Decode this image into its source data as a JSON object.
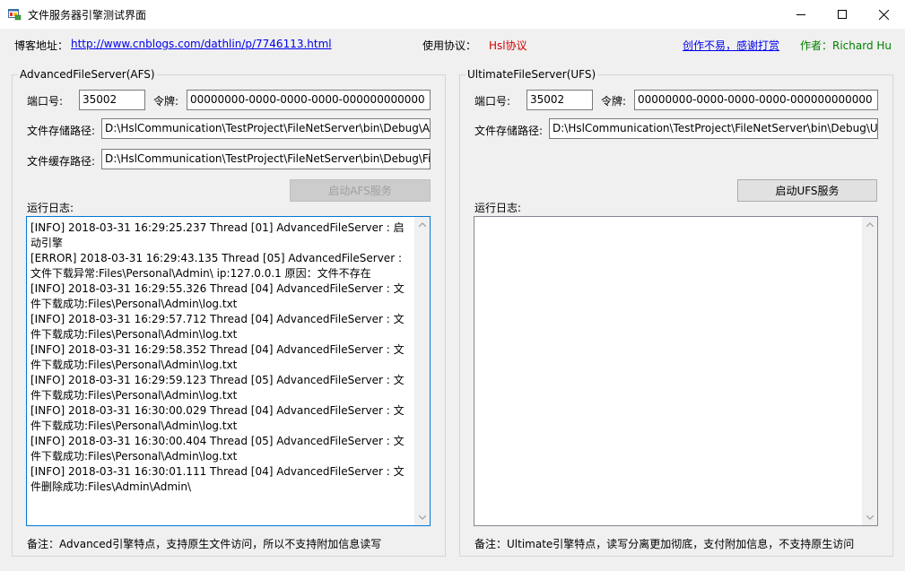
{
  "window": {
    "title": "文件服务器引擎测试界面"
  },
  "header": {
    "blog_label": "博客地址：",
    "blog_url": "http://www.cnblogs.com/dathlin/p/7746113.html",
    "protocol_label": "使用协议：",
    "protocol_value": "Hsl协议",
    "donate_link": "创作不易，感谢打赏",
    "author_label": "作者：Richard Hu"
  },
  "afs": {
    "group_title": "AdvancedFileServer(AFS)",
    "port_label": "端口号:",
    "port_value": "35002",
    "token_label": "令牌:",
    "token_value": "00000000-0000-0000-0000-000000000000",
    "storage_label": "文件存储路径:",
    "storage_value": "D:\\HslCommunication\\TestProject\\FileNetServer\\bin\\Debug\\Ac",
    "cache_label": "文件缓存路径:",
    "cache_value": "D:\\HslCommunication\\TestProject\\FileNetServer\\bin\\Debug\\File",
    "start_button": "启动AFS服务",
    "log_label": "运行日志:",
    "log_lines": [
      "[INFO] 2018-03-31 16:29:25.237 Thread [01] AdvancedFileServer : 启动引擎",
      "[ERROR] 2018-03-31 16:29:43.135 Thread [05] AdvancedFileServer : 文件下载异常:Files\\Personal\\Admin\\ ip:127.0.0.1 原因：文件不存在",
      "[INFO] 2018-03-31 16:29:55.326 Thread [04] AdvancedFileServer : 文件下载成功:Files\\Personal\\Admin\\log.txt",
      "[INFO] 2018-03-31 16:29:57.712 Thread [04] AdvancedFileServer : 文件下载成功:Files\\Personal\\Admin\\log.txt",
      "[INFO] 2018-03-31 16:29:58.352 Thread [04] AdvancedFileServer : 文件下载成功:Files\\Personal\\Admin\\log.txt",
      "[INFO] 2018-03-31 16:29:59.123 Thread [05] AdvancedFileServer : 文件下载成功:Files\\Personal\\Admin\\log.txt",
      "[INFO] 2018-03-31 16:30:00.029 Thread [04] AdvancedFileServer : 文件下载成功:Files\\Personal\\Admin\\log.txt",
      "[INFO] 2018-03-31 16:30:00.404 Thread [05] AdvancedFileServer : 文件下载成功:Files\\Personal\\Admin\\log.txt",
      "[INFO] 2018-03-31 16:30:01.111 Thread [04] AdvancedFileServer : 文件删除成功:Files\\Admin\\Admin\\"
    ],
    "note": "备注：Advanced引擎特点，支持原生文件访问，所以不支持附加信息读写"
  },
  "ufs": {
    "group_title": "UltimateFileServer(UFS)",
    "port_label": "端口号:",
    "port_value": "35002",
    "token_label": "令牌:",
    "token_value": "00000000-0000-0000-0000-000000000000",
    "storage_label": "文件存储路径:",
    "storage_value": "D:\\HslCommunication\\TestProject\\FileNetServer\\bin\\Debug\\Ult",
    "start_button": "启动UFS服务",
    "log_label": "运行日志:",
    "note": "备注：Ultimate引擎特点，读写分离更加彻底，支付附加信息，不支持原生访问"
  }
}
